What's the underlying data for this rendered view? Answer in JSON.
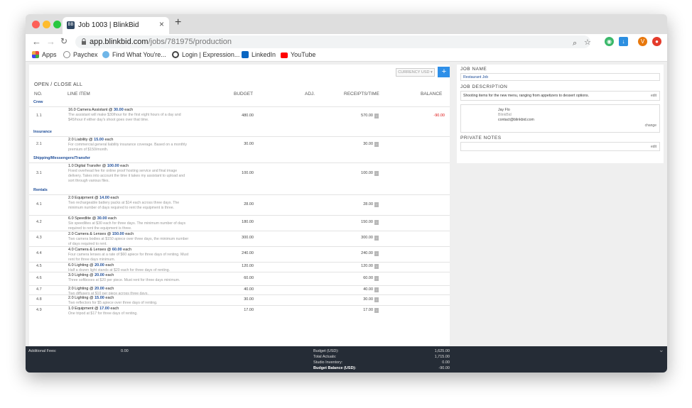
{
  "browser": {
    "tab_title": "Job 1003 | BlinkBid",
    "tab_close": "×",
    "new_tab": "+",
    "url_host": "app.blinkbid.com",
    "url_path": "/jobs/781975/production",
    "profile_initial": "V",
    "bookmarks": [
      "Apps",
      "Paychex",
      "Find What You're...",
      "Login | Expression...",
      "LinkedIn",
      "YouTube"
    ]
  },
  "toolbar": {
    "currency_label": "CURRENCY USD ▾",
    "add_label": "+",
    "toggle_all": "OPEN / CLOSE ALL"
  },
  "table": {
    "columns": {
      "no": "NO.",
      "line_item": "LINE ITEM",
      "budget": "BUDGET",
      "adj": "ADJ.",
      "receipts": "RECEIPTS/TIME",
      "balance": "BALANCE"
    },
    "categories": [
      {
        "name": "Crew",
        "rows": [
          {
            "no": "1.1",
            "title_pre": "16.0 Camera Assistant @ ",
            "rate": "30.00",
            "title_post": " each",
            "desc": "The assistant will make $30/hour for the first eight hours of a day and $45/hour if either day's shoot goes over that time.",
            "budget": "480.00",
            "receipts": "570.00",
            "balance": "-90.00"
          }
        ]
      },
      {
        "name": "Insurance",
        "rows": [
          {
            "no": "2.1",
            "title_pre": "2.0 Liability @ ",
            "rate": "15.00",
            "title_post": " each",
            "desc": "For commercial general liability insurance coverage. Based on a monthly premium of $150/month.",
            "budget": "30.00",
            "receipts": "30.00",
            "balance": ""
          }
        ]
      },
      {
        "name": "Shipping/Messengers/Transfer",
        "rows": [
          {
            "no": "3.1",
            "title_pre": "1.0 Digital Transfer @ ",
            "rate": "100.00",
            "title_post": " each",
            "desc": "Fixed overhead fee for online proof hosting service and final image delivery. Takes into account the time it takes my assistant to upload and sort through various files.",
            "budget": "100.00",
            "receipts": "100.00",
            "balance": ""
          }
        ]
      },
      {
        "name": "Rentals",
        "rows": [
          {
            "no": "4.1",
            "title_pre": "2.0 Equipment @ ",
            "rate": "14.00",
            "title_post": " each",
            "desc": "Two rechargeable battery packs at $14 each across three days. The minimum number of days required to rent the equipment is three.",
            "budget": "28.00",
            "receipts": "28.00",
            "balance": ""
          },
          {
            "no": "4.2",
            "title_pre": "6.0 Speedlite @ ",
            "rate": "30.00",
            "title_post": " each",
            "desc": "Six speedlites at $30 each for three days. The minimum number of days required to rent the equipment is three.",
            "budget": "180.00",
            "receipts": "150.00",
            "balance": ""
          },
          {
            "no": "4.3",
            "title_pre": "2.0 Camera & Lenses @ ",
            "rate": "150.00",
            "title_post": " each",
            "desc": "Two camera bodies at $150 apiece over three days, the minimum number of days required to rent.",
            "budget": "300.00",
            "receipts": "300.00",
            "balance": ""
          },
          {
            "no": "4.4",
            "title_pre": "4.0 Camera & Lenses @ ",
            "rate": "60.00",
            "title_post": " each",
            "desc": "Four camera lenses at a rate of $60 apiece for three days of renting. Must rent for three days minimum.",
            "budget": "240.00",
            "receipts": "240.00",
            "balance": ""
          },
          {
            "no": "4.5",
            "title_pre": "6.0 Lighting @ ",
            "rate": "20.00",
            "title_post": " each",
            "desc": "Half a dozen light stands at $20 each for three days of renting.",
            "budget": "120.00",
            "receipts": "120.00",
            "balance": ""
          },
          {
            "no": "4.6",
            "title_pre": "3.0 Lighting @ ",
            "rate": "20.00",
            "title_post": " each",
            "desc": "Three softboxes at $20 per piece. Must rent for three days minimum.",
            "budget": "60.00",
            "receipts": "60.00",
            "balance": ""
          },
          {
            "no": "4.7",
            "title_pre": "2.0 Lighting @ ",
            "rate": "20.00",
            "title_post": " each",
            "desc": "Two diffusers at $10 per piece across three days.",
            "budget": "40.00",
            "receipts": "40.00",
            "balance": ""
          },
          {
            "no": "4.8",
            "title_pre": "2.0 Lighting @ ",
            "rate": "15.00",
            "title_post": " each",
            "desc": "Two reflectors for $5 apiece over three days of renting.",
            "budget": "30.00",
            "receipts": "30.00",
            "balance": ""
          },
          {
            "no": "4.9",
            "title_pre": "1.0 Equipment @ ",
            "rate": "17.00",
            "title_post": " each",
            "desc": "One tripod at $17 for three days of renting.",
            "budget": "17.00",
            "receipts": "17.00",
            "balance": ""
          }
        ]
      }
    ]
  },
  "job": {
    "name_label": "JOB NAME",
    "name_value": "Restaurant Job",
    "desc_label": "JOB DESCRIPTION",
    "desc_value": "Shooting items for the new menu, ranging from appetizers to dessert options.",
    "edit_label": "edit",
    "contact_name": "Jay Flo",
    "contact_company": "BlinkBid",
    "contact_email": "contact@blinkbid.com",
    "change_label": "change",
    "notes_label": "PRIVATE NOTES"
  },
  "footer": {
    "additional_fees_label": "Additional Fees:",
    "additional_fees_value": "0.00",
    "budget_label": "Budget (USD):",
    "budget_value": "1,625.00",
    "actuals_label": "Total Actuals:",
    "actuals_value": "1,715.00",
    "inventory_label": "Studio Inventory:",
    "inventory_value": "0.00",
    "balance_label": "Budget Balance (USD):",
    "balance_value": "-90.00",
    "collapse": "⌄"
  },
  "colors": {
    "accent": "#2e8fe8",
    "link": "#1f4e99",
    "negative": "#dd1111",
    "footer_bg": "#252c36"
  }
}
